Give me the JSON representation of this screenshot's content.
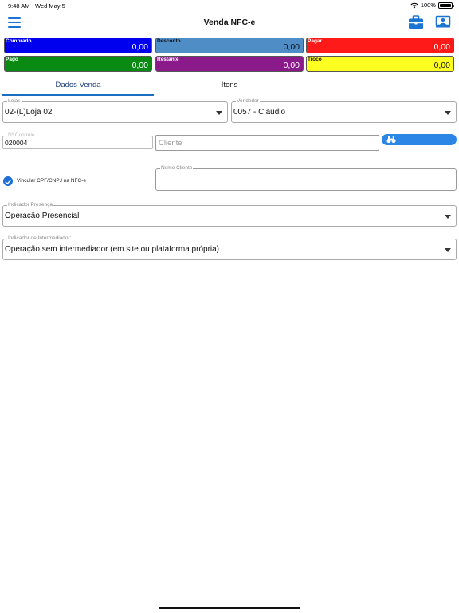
{
  "status_bar": {
    "time": "9:48 AM",
    "date": "Wed May 5",
    "battery": "100%"
  },
  "header": {
    "title": "Venda NFC-e",
    "menu_icon": "hamburger-menu-icon",
    "right_icons": [
      "briefcase-icon",
      "cashier-icon"
    ]
  },
  "summary": {
    "comprado": {
      "label": "Comprado",
      "value": "0,00",
      "color": "#0000ee"
    },
    "desconto": {
      "label": "Desconto",
      "value": "0,00",
      "color": "#4f8dc6"
    },
    "pagar": {
      "label": "Pagar",
      "value": "0,00",
      "color": "#ff1a1a"
    },
    "pago": {
      "label": "Pago",
      "value": "0,00",
      "color": "#0a8a12"
    },
    "restante": {
      "label": "Restante",
      "value": "0,00",
      "color": "#8a1a8a"
    },
    "troco": {
      "label": "Troco",
      "value": "0,00",
      "color": "#ffff22"
    }
  },
  "tabs": [
    {
      "label": "Dados Venda",
      "active": true
    },
    {
      "label": "Itens",
      "active": false
    }
  ],
  "form": {
    "lojas": {
      "legend": "Lojas",
      "value": "02-(L)Loja 02"
    },
    "vendedor": {
      "legend": "Vendedor",
      "value": "0057 - Claudio"
    },
    "controle": {
      "legend": "Nº Controle",
      "value": "020004"
    },
    "cliente": {
      "placeholder": "Cliente"
    },
    "vincular_cpf": {
      "label": "Vincular CPF/CNPJ na NFC-e",
      "checked": true
    },
    "nome_cliente": {
      "legend": "Nome Cliente",
      "value": ""
    },
    "indicador_presenca": {
      "legend": "Indicador Presença",
      "value": "Operação Presencial"
    },
    "indicador_intermediador": {
      "legend": "Indicador de Intermediador:",
      "value": "Operação sem intermediador (em site ou plataforma própria)"
    }
  },
  "colors": {
    "accent": "#1a75d2",
    "tab_active_text": "#16397a"
  }
}
